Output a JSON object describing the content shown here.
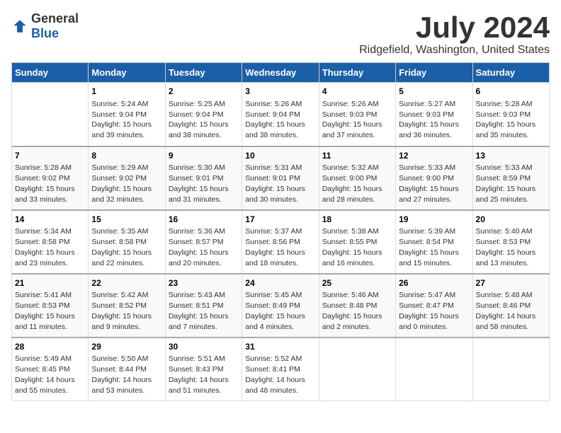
{
  "logo": {
    "general": "General",
    "blue": "Blue"
  },
  "title": "July 2024",
  "subtitle": "Ridgefield, Washington, United States",
  "headers": [
    "Sunday",
    "Monday",
    "Tuesday",
    "Wednesday",
    "Thursday",
    "Friday",
    "Saturday"
  ],
  "weeks": [
    [
      {
        "day": "",
        "info": ""
      },
      {
        "day": "1",
        "info": "Sunrise: 5:24 AM\nSunset: 9:04 PM\nDaylight: 15 hours\nand 39 minutes."
      },
      {
        "day": "2",
        "info": "Sunrise: 5:25 AM\nSunset: 9:04 PM\nDaylight: 15 hours\nand 38 minutes."
      },
      {
        "day": "3",
        "info": "Sunrise: 5:26 AM\nSunset: 9:04 PM\nDaylight: 15 hours\nand 38 minutes."
      },
      {
        "day": "4",
        "info": "Sunrise: 5:26 AM\nSunset: 9:03 PM\nDaylight: 15 hours\nand 37 minutes."
      },
      {
        "day": "5",
        "info": "Sunrise: 5:27 AM\nSunset: 9:03 PM\nDaylight: 15 hours\nand 36 minutes."
      },
      {
        "day": "6",
        "info": "Sunrise: 5:28 AM\nSunset: 9:03 PM\nDaylight: 15 hours\nand 35 minutes."
      }
    ],
    [
      {
        "day": "7",
        "info": "Sunrise: 5:28 AM\nSunset: 9:02 PM\nDaylight: 15 hours\nand 33 minutes."
      },
      {
        "day": "8",
        "info": "Sunrise: 5:29 AM\nSunset: 9:02 PM\nDaylight: 15 hours\nand 32 minutes."
      },
      {
        "day": "9",
        "info": "Sunrise: 5:30 AM\nSunset: 9:01 PM\nDaylight: 15 hours\nand 31 minutes."
      },
      {
        "day": "10",
        "info": "Sunrise: 5:31 AM\nSunset: 9:01 PM\nDaylight: 15 hours\nand 30 minutes."
      },
      {
        "day": "11",
        "info": "Sunrise: 5:32 AM\nSunset: 9:00 PM\nDaylight: 15 hours\nand 28 minutes."
      },
      {
        "day": "12",
        "info": "Sunrise: 5:33 AM\nSunset: 9:00 PM\nDaylight: 15 hours\nand 27 minutes."
      },
      {
        "day": "13",
        "info": "Sunrise: 5:33 AM\nSunset: 8:59 PM\nDaylight: 15 hours\nand 25 minutes."
      }
    ],
    [
      {
        "day": "14",
        "info": "Sunrise: 5:34 AM\nSunset: 8:58 PM\nDaylight: 15 hours\nand 23 minutes."
      },
      {
        "day": "15",
        "info": "Sunrise: 5:35 AM\nSunset: 8:58 PM\nDaylight: 15 hours\nand 22 minutes."
      },
      {
        "day": "16",
        "info": "Sunrise: 5:36 AM\nSunset: 8:57 PM\nDaylight: 15 hours\nand 20 minutes."
      },
      {
        "day": "17",
        "info": "Sunrise: 5:37 AM\nSunset: 8:56 PM\nDaylight: 15 hours\nand 18 minutes."
      },
      {
        "day": "18",
        "info": "Sunrise: 5:38 AM\nSunset: 8:55 PM\nDaylight: 15 hours\nand 16 minutes."
      },
      {
        "day": "19",
        "info": "Sunrise: 5:39 AM\nSunset: 8:54 PM\nDaylight: 15 hours\nand 15 minutes."
      },
      {
        "day": "20",
        "info": "Sunrise: 5:40 AM\nSunset: 8:53 PM\nDaylight: 15 hours\nand 13 minutes."
      }
    ],
    [
      {
        "day": "21",
        "info": "Sunrise: 5:41 AM\nSunset: 8:53 PM\nDaylight: 15 hours\nand 11 minutes."
      },
      {
        "day": "22",
        "info": "Sunrise: 5:42 AM\nSunset: 8:52 PM\nDaylight: 15 hours\nand 9 minutes."
      },
      {
        "day": "23",
        "info": "Sunrise: 5:43 AM\nSunset: 8:51 PM\nDaylight: 15 hours\nand 7 minutes."
      },
      {
        "day": "24",
        "info": "Sunrise: 5:45 AM\nSunset: 8:49 PM\nDaylight: 15 hours\nand 4 minutes."
      },
      {
        "day": "25",
        "info": "Sunrise: 5:46 AM\nSunset: 8:48 PM\nDaylight: 15 hours\nand 2 minutes."
      },
      {
        "day": "26",
        "info": "Sunrise: 5:47 AM\nSunset: 8:47 PM\nDaylight: 15 hours\nand 0 minutes."
      },
      {
        "day": "27",
        "info": "Sunrise: 5:48 AM\nSunset: 8:46 PM\nDaylight: 14 hours\nand 58 minutes."
      }
    ],
    [
      {
        "day": "28",
        "info": "Sunrise: 5:49 AM\nSunset: 8:45 PM\nDaylight: 14 hours\nand 55 minutes."
      },
      {
        "day": "29",
        "info": "Sunrise: 5:50 AM\nSunset: 8:44 PM\nDaylight: 14 hours\nand 53 minutes."
      },
      {
        "day": "30",
        "info": "Sunrise: 5:51 AM\nSunset: 8:43 PM\nDaylight: 14 hours\nand 51 minutes."
      },
      {
        "day": "31",
        "info": "Sunrise: 5:52 AM\nSunset: 8:41 PM\nDaylight: 14 hours\nand 48 minutes."
      },
      {
        "day": "",
        "info": ""
      },
      {
        "day": "",
        "info": ""
      },
      {
        "day": "",
        "info": ""
      }
    ]
  ]
}
